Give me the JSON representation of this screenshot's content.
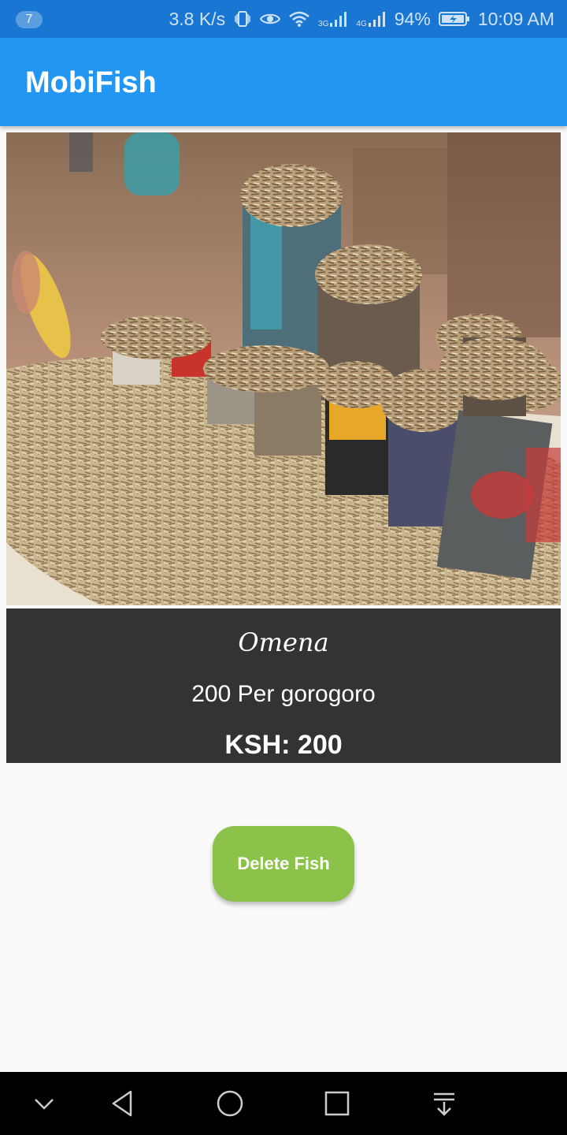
{
  "status_bar": {
    "notification_count": "7",
    "net_speed": "3.8 K/s",
    "signal1_label": "3G",
    "signal2_label": "4G",
    "battery": "94%",
    "time": "10:09 AM",
    "icons": [
      "vibrate-icon",
      "eye-icon",
      "wifi-icon",
      "signal-icon",
      "signal-icon",
      "battery-charging-icon"
    ]
  },
  "app_bar": {
    "title": "MobiFish"
  },
  "fish": {
    "image": "dried-omena-fish-photo",
    "name": "Omena",
    "description": "200 Per gorogoro",
    "price": "KSH: 200"
  },
  "actions": {
    "delete_label": "Delete Fish"
  },
  "nav_bar": {
    "icons": [
      "chevron-down-icon",
      "back-icon",
      "home-icon",
      "recents-icon",
      "notification-pull-icon"
    ]
  },
  "colors": {
    "status_bar": "#1976d2",
    "app_bar": "#2196f3",
    "info_panel": "#333333",
    "button": "#8bc34a",
    "background": "#fafafa"
  }
}
